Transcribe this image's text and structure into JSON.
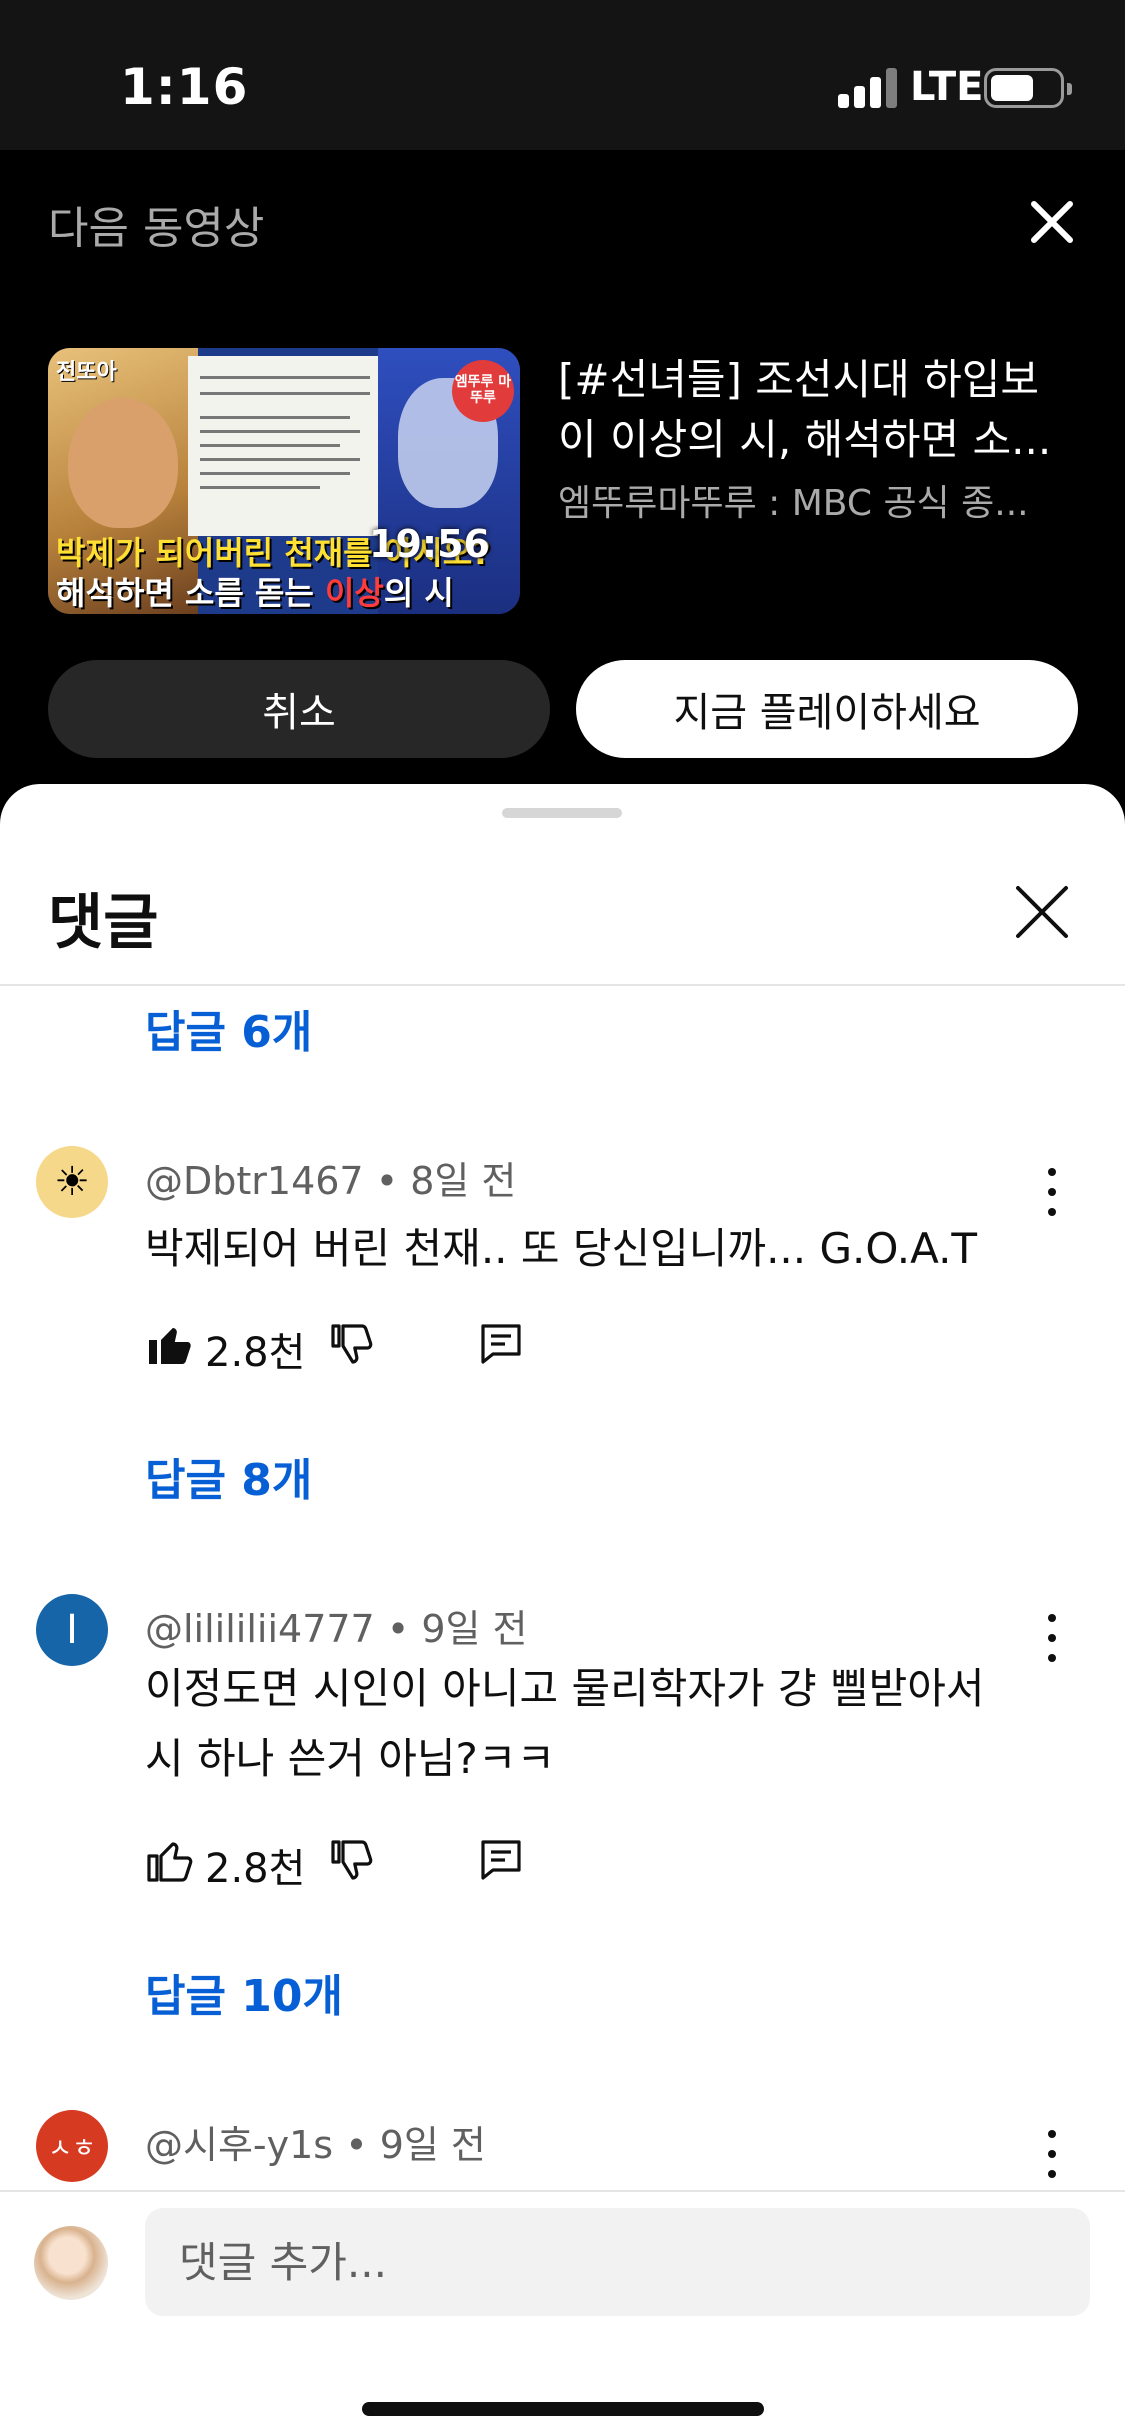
{
  "status_bar": {
    "time": "1:16",
    "network": "LTE"
  },
  "up_next": {
    "label": "다음 동영상",
    "close_icon": "close-icon",
    "thumbnail": {
      "tag_left": "전또아",
      "tag_right": "엠뚜루 마뚜루",
      "caption_line1": "박제가 되어버린 천재를 아시오?",
      "caption_line2_a": "해석하면 소름 돋는 ",
      "caption_line2_b": "이상",
      "caption_line2_c": "의 시",
      "duration": "19:56"
    },
    "title_line1": "[#선녀들] 조선시대 하입보",
    "title_line2": "이 이상의 시, 해석하면 소...",
    "channel": "엠뚜루마뚜루 : MBC 공식 종...",
    "cancel_label": "취소",
    "play_label": "지금 플레이하세요"
  },
  "comments": {
    "title": "댓글",
    "close_icon": "close-icon",
    "top_replies": "답글 6개",
    "items": [
      {
        "avatar": "☀",
        "author": "@Dbtr1467",
        "age": "8일 전",
        "text": "박제되어 버린 천재.. 또 당신입니까... G.O.A.T",
        "likes": "2.8천",
        "liked": true,
        "replies": "답글 8개"
      },
      {
        "avatar": "I",
        "author": "@lilililii4777",
        "age": "9일 전",
        "text_line1": "이정도면 시인이 아니고 물리학자가 걍 삘받아서",
        "text_line2": "시 하나 쓴거 아님?ㅋㅋ",
        "likes": "2.8천",
        "liked": false,
        "replies": "답글 10개"
      },
      {
        "avatar": "ㅅㅎ",
        "author": "@시후-y1s",
        "age": "9일 전"
      }
    ],
    "input_placeholder": "댓글 추가..."
  },
  "colors": {
    "link": "#065fd4",
    "sheet_bg": "#ffffff",
    "panel_bg": "#000000"
  }
}
